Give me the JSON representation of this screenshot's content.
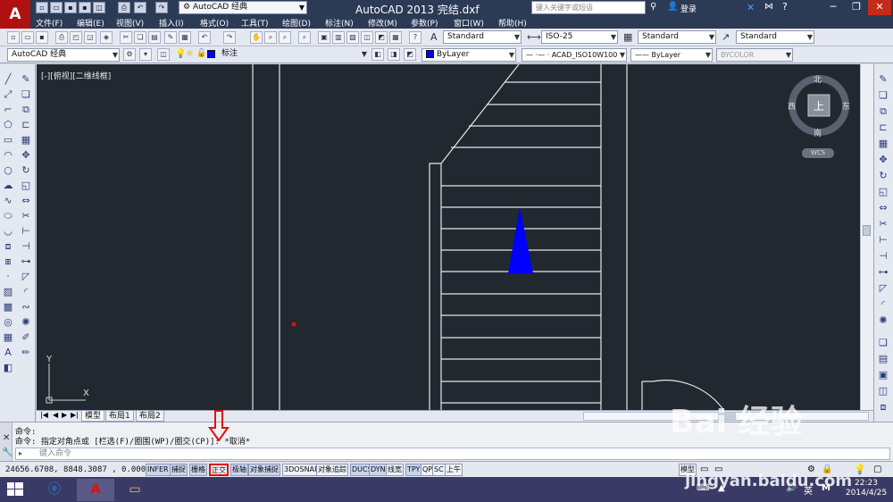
{
  "app": {
    "logo": "A",
    "workspace": "AutoCAD 经典",
    "window_title": "AutoCAD 2013    完结.dxf",
    "search_placeholder": "键入关键字或短语",
    "login": "登录"
  },
  "menus": [
    "文件(F)",
    "编辑(E)",
    "视图(V)",
    "插入(I)",
    "格式(O)",
    "工具(T)",
    "绘图(D)",
    "标注(N)",
    "修改(M)",
    "参数(P)",
    "窗口(W)",
    "帮助(H)"
  ],
  "toolbar1": {
    "text_style": "Standard",
    "dim_style": "ISO-25",
    "table_style": "Standard",
    "multileader_style": "Standard"
  },
  "toolbar2": {
    "workspace": "AutoCAD 经典",
    "layer": "标注",
    "color": "ByLayer",
    "linetype": "ACAD_ISO10W100",
    "lineweight": "ByLayer",
    "plotstyle": "BYCOLOR"
  },
  "canvas": {
    "view_label": "[-][俯视][二维线框]",
    "compass": {
      "north": "北",
      "south": "南",
      "east": "东",
      "west": "西",
      "center": "上"
    },
    "wcs": "WCS",
    "ucs_y": "Y",
    "ucs_x": "X"
  },
  "layout_tabs": [
    "模型",
    "布局1",
    "布局2"
  ],
  "command": {
    "line1": "命令:",
    "line2": "命令: 指定对角点或 [栏选(F)/圈围(WP)/圈交(CP)]: *取消*",
    "placeholder": "键入命令"
  },
  "status": {
    "coords": "24656.6708, 8848.3087 , 0.0000",
    "buttons": [
      {
        "label": "INFER",
        "on": true
      },
      {
        "label": "捕捉",
        "on": true
      },
      {
        "label": "栅格",
        "on": true
      },
      {
        "label": "正交",
        "on": false
      },
      {
        "label": "极轴",
        "on": true
      },
      {
        "label": "对象捕捉",
        "on": true
      },
      {
        "label": "3DOSNAP",
        "on": false
      },
      {
        "label": "对象追踪",
        "on": false
      },
      {
        "label": "DUCS",
        "on": true
      },
      {
        "label": "DYN",
        "on": true
      },
      {
        "label": "线宽",
        "on": false
      },
      {
        "label": "TPY",
        "on": true
      },
      {
        "label": "QP",
        "on": false
      },
      {
        "label": "SC",
        "on": false
      },
      {
        "label": "上午",
        "on": false
      }
    ],
    "model_label": "模型"
  },
  "taskbar": {
    "time": "22:23",
    "date": "2014/4/25",
    "ime": "英"
  },
  "watermark": {
    "brand": "Bai  经验",
    "url": "jingyan.baidu.com"
  },
  "colors": {
    "canvas_bg": "#212830",
    "highlight": "#e01010",
    "triangle": "#0000ff",
    "title_bg": "#2b3a55"
  }
}
